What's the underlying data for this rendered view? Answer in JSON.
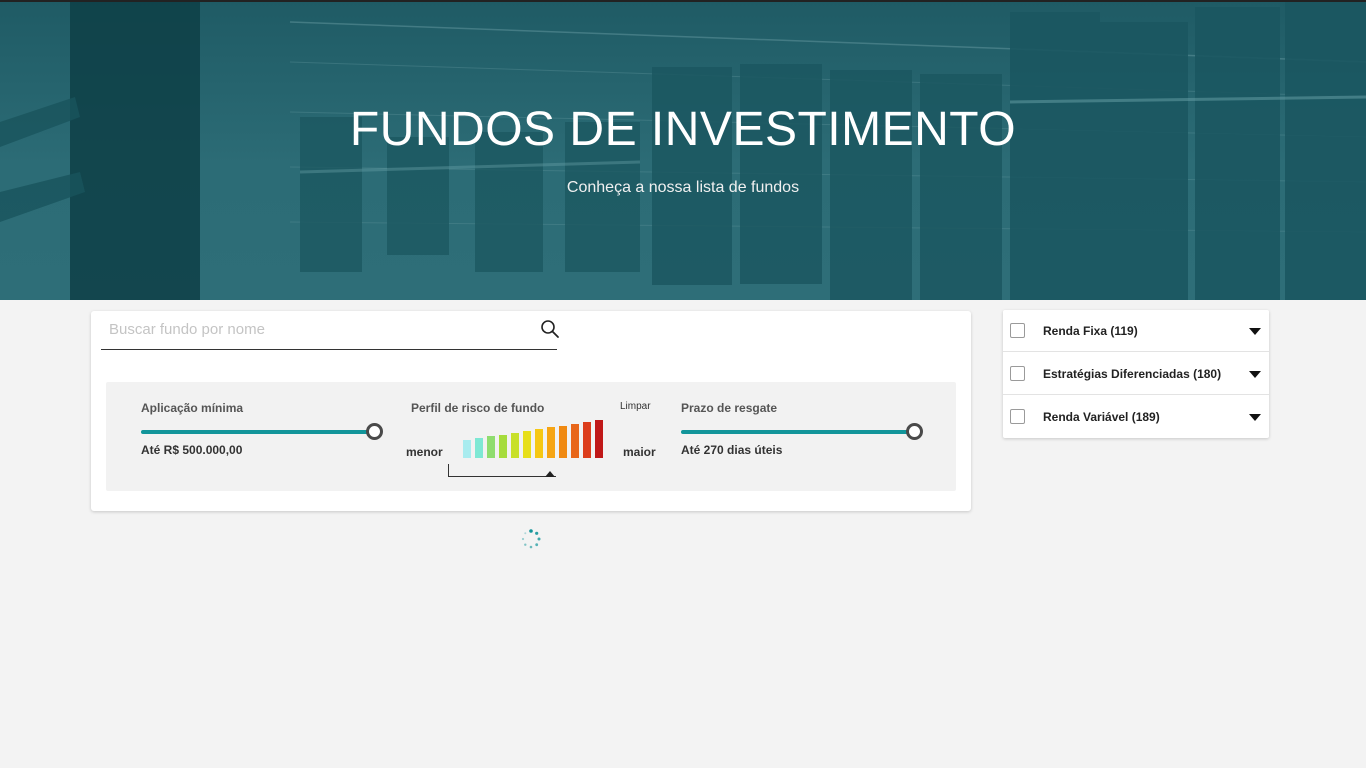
{
  "hero": {
    "title": "FUNDOS DE INVESTIMENTO",
    "subtitle": "Conheça a nossa lista de fundos"
  },
  "search": {
    "placeholder": "Buscar fundo por nome",
    "value": "",
    "icon": "search-icon"
  },
  "filters": {
    "aplicacao": {
      "label": "Aplicação mínima",
      "value_text": "Até R$ 500.000,00",
      "level": 1.0
    },
    "risco": {
      "label": "Perfil de risco de fundo",
      "clear_label": "Limpar",
      "low_label": "menor",
      "high_label": "maior",
      "bar_colors": [
        "#a9ecef",
        "#7ee8d4",
        "#8fdd6f",
        "#a6dc3c",
        "#c8e02a",
        "#e7df1a",
        "#f6c814",
        "#f6a514",
        "#f08a12",
        "#e8661a",
        "#dc3d1c",
        "#c01818"
      ]
    },
    "prazo": {
      "label": "Prazo de resgate",
      "value_text": "Até 270 dias úteis",
      "level": 1.0
    }
  },
  "categories": [
    {
      "label": "Renda Fixa (119)",
      "checked": false
    },
    {
      "label": "Estratégias Diferenciadas (180)",
      "checked": false
    },
    {
      "label": "Renda Variável (189)",
      "checked": false
    }
  ],
  "colors": {
    "accent": "#12959a",
    "hero_bg": "#2c6c76",
    "page_bg": "#f3f3f3"
  }
}
